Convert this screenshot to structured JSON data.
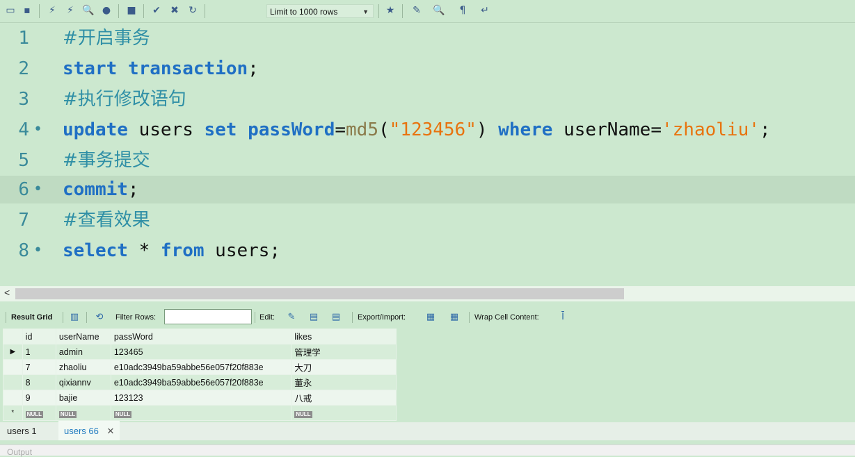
{
  "toolbar": {
    "icons": [
      "folder-icon",
      "save-icon",
      "execute-icon",
      "execute-statement-icon",
      "explain-icon",
      "stop-icon",
      "toggle-continue-icon",
      "commit-icon",
      "rollback-icon",
      "autocommit-icon"
    ],
    "limit_label": "Limit to 1000 rows",
    "right_icons": [
      "bookmark-icon",
      "beautify-icon",
      "find-icon",
      "invisible-chars-icon",
      "wrap-icon"
    ]
  },
  "editor": {
    "lines": [
      {
        "num": "1",
        "marker": "",
        "comment": "#开启事务"
      },
      {
        "num": "2",
        "marker": "",
        "kw1": "start",
        "kw2": "transaction",
        "tail": ";"
      },
      {
        "num": "3",
        "marker": "",
        "comment": "#执行修改语句"
      },
      {
        "num": "4",
        "marker": "•",
        "kw_update": "update",
        "t_users": " users ",
        "kw_set": "set",
        "kw_pw": " passWord",
        "eq": "=",
        "fn_md5": "md5",
        "lp": "(",
        "str1": "\"123456\"",
        "rp": ")",
        "kw_where": " where",
        "t_un": " userName",
        "eq2": "=",
        "str2": "'zhaoliu'",
        "semi": ";"
      },
      {
        "num": "5",
        "marker": "",
        "comment": "#事务提交"
      },
      {
        "num": "6",
        "marker": "•",
        "kw1": "commit",
        "tail": ";"
      },
      {
        "num": "7",
        "marker": "",
        "comment": "#查看效果"
      },
      {
        "num": "8",
        "marker": "•",
        "kw_select": "select",
        "star": " * ",
        "kw_from": "from",
        "t_users": " users;"
      }
    ]
  },
  "result_toolbar": {
    "result_grid": "Result Grid",
    "filter_rows": "Filter Rows:",
    "filter_value": "",
    "edit": "Edit:",
    "export_import": "Export/Import:",
    "wrap": "Wrap Cell Content:"
  },
  "grid": {
    "columns": [
      "id",
      "userName",
      "passWord",
      "likes"
    ],
    "rows": [
      [
        "1",
        "admin",
        "123465",
        "管理学"
      ],
      [
        "7",
        "zhaoliu",
        "e10adc3949ba59abbe56e057f20f883e",
        "大刀"
      ],
      [
        "8",
        "qixiannv",
        "e10adc3949ba59abbe56e057f20f883e",
        "董永"
      ],
      [
        "9",
        "bajie",
        "123123",
        "八戒"
      ]
    ],
    "null_label": "NULL",
    "current_row_marker": "▶",
    "new_row_marker": "*"
  },
  "tabs": [
    {
      "label": "users 1"
    },
    {
      "label": "users 66"
    }
  ],
  "output": {
    "label": "Output"
  }
}
